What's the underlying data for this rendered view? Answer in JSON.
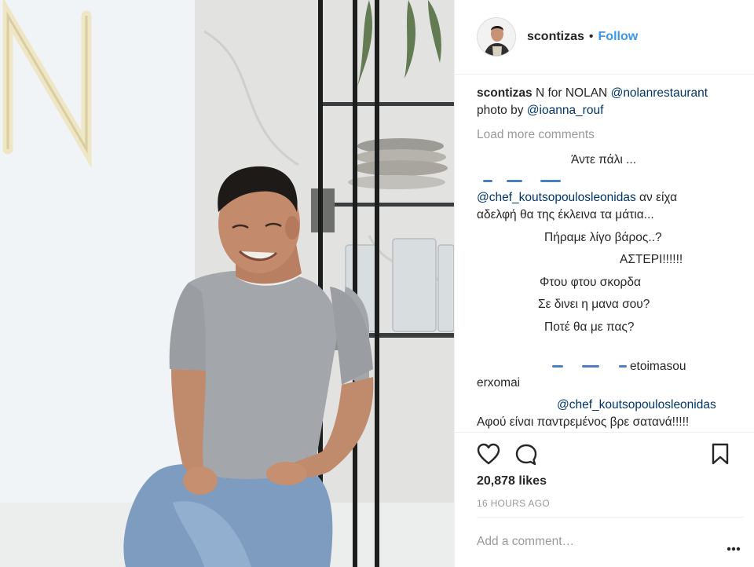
{
  "header": {
    "username": "scontizas",
    "separator": "•",
    "follow_label": "Follow"
  },
  "caption": {
    "username": "scontizas",
    "text": "N for NOLAN",
    "mention1": "@nolanrestaurant",
    "line2_prefix": "photo by",
    "mention2": "@ioanna_rouf"
  },
  "load_more": "Load more comments",
  "comments": [
    {
      "text": "Άντε πάλι ..."
    },
    {
      "mention": "@chef_koutsopoulosleonidas",
      "text": "αν είχα",
      "text2": "αδελφή θα της έκλεινα τα μάτια..."
    },
    {
      "text": "Πήραμε λίγο βάρος..?"
    },
    {
      "text": "ΑΣΤΕΡΙ!!!!!!"
    },
    {
      "text": "Φτου φτου σκορδα"
    },
    {
      "text": "Σε δινει η μανα σου?"
    },
    {
      "text": "Ποτέ θα με πας?"
    },
    {
      "text": "etoimasou",
      "text2": "erxomai"
    },
    {
      "mention": "@chef_koutsopoulosleonidas",
      "text2": "Αφού είναι παντρεμένος βρε σατανά!!!!!"
    }
  ],
  "likes": "20,878 likes",
  "time_ago": "16 HOURS AGO",
  "add_comment_placeholder": "Add a comment…",
  "icons": {
    "like": "heart-icon",
    "comment": "comment-bubble-icon",
    "save": "bookmark-icon",
    "more": "more-options-icon"
  },
  "colors": {
    "link": "#003569",
    "follow": "#3897f0",
    "muted": "#999999"
  }
}
